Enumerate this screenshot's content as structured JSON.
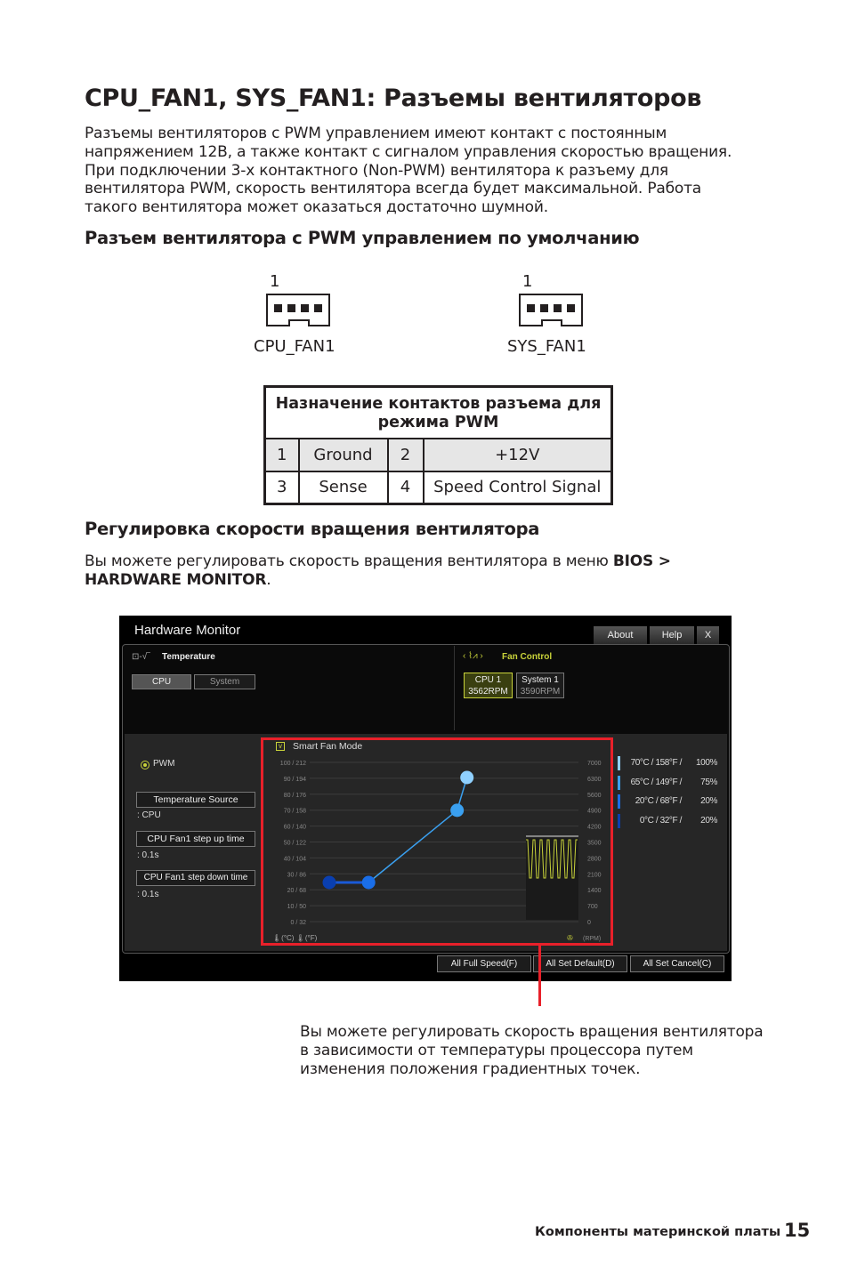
{
  "title": "CPU_FAN1, SYS_FAN1: Разъемы вентиляторов",
  "intro": [
    "Разъемы вентиляторов с PWM управлением имеют контакт с постоянным",
    "напряжением 12В, а также контакт с сигналом управления скоростью вращения.",
    "При подключении 3-х контактного (Non-PWM) вентилятора к разъему для",
    "вентилятора PWM, скорость вентилятора всегда будет максимальной. Работа",
    "такого вентилятора может оказаться достаточно шумной."
  ],
  "section1": "Разъем вентилятора с PWM управлением по умолчанию",
  "connectors": [
    {
      "pin_label": "1",
      "name": "CPU_FAN1"
    },
    {
      "pin_label": "1",
      "name": "SYS_FAN1"
    }
  ],
  "pin_table": {
    "header": [
      "Назначение контактов разъема для",
      "режима PWM"
    ],
    "rows": [
      [
        "1",
        "Ground",
        "2",
        "+12V"
      ],
      [
        "3",
        "Sense",
        "4",
        "Speed Control Signal"
      ]
    ]
  },
  "section2": "Регулировка скорости вращения вентилятора",
  "para2": {
    "text": "Вы можете регулировать скорость вращения вентилятора в меню ",
    "bold1": "BIOS >",
    "bold2": "HARDWARE MONITOR",
    "end": "."
  },
  "bios": {
    "title": "Hardware Monitor",
    "tabs": [
      "About",
      "Help",
      "X"
    ],
    "temperature": {
      "label": "Temperature",
      "buttons": [
        "CPU",
        "System"
      ]
    },
    "fan_control": {
      "label": "Fan Control",
      "fans": [
        {
          "name": "CPU 1",
          "rpm": "3562RPM",
          "selected": true
        },
        {
          "name": "System 1",
          "rpm": "3590RPM",
          "selected": false
        }
      ]
    },
    "mode": "PWM",
    "settings": [
      {
        "button": "Temperature Source",
        "value": ": CPU"
      },
      {
        "button": "CPU Fan1 step up time",
        "value": ": 0.1s"
      },
      {
        "button": "CPU Fan1 step down time",
        "value": ": 0.1s"
      }
    ],
    "smart_fan_mode": "Smart Fan Mode",
    "smart_fan_checked": true,
    "left_axis": [
      "100 / 212",
      "90 / 194",
      "80 / 176",
      "70 / 158",
      "60 / 140",
      "50 / 122",
      "40 / 104",
      "30 /  86",
      "20 /  68",
      "10 /  50",
      "0 /  32"
    ],
    "right_axis": [
      "7000",
      "6300",
      "5600",
      "4900",
      "4200",
      "3500",
      "2800",
      "2100",
      "1400",
      "700",
      "0"
    ],
    "unit_c": "(°C)",
    "unit_f": "(°F)",
    "unit_rpm": "(RPM)",
    "points": [
      {
        "label": "70°C / 158°F /",
        "temp": 70,
        "percent": 100,
        "display": "100%",
        "color": "#8fd0ff"
      },
      {
        "label": "65°C / 149°F /",
        "temp": 65,
        "percent": 75,
        "display": "75%",
        "color": "#3aa0f0"
      },
      {
        "label": "20°C / 68°F /",
        "temp": 20,
        "percent": 20,
        "display": "20%",
        "color": "#1a6ee8"
      },
      {
        "label": "0°C / 32°F /",
        "temp": 0,
        "percent": 20,
        "display": "20%",
        "color": "#0a3fb0"
      }
    ],
    "bottom_buttons": [
      "All Full Speed(F)",
      "All Set Default(D)",
      "All Set Cancel(C)"
    ],
    "highlight_color": "#e8202a",
    "accent_color": "#c8d23a"
  },
  "caption": [
    "Вы можете регулировать скорость вращения вентилятора",
    "в зависимости от температуры процессора путем",
    "изменения положения градиентных  точек."
  ],
  "footer": {
    "section": "Компоненты материнской платы",
    "page": "15"
  }
}
